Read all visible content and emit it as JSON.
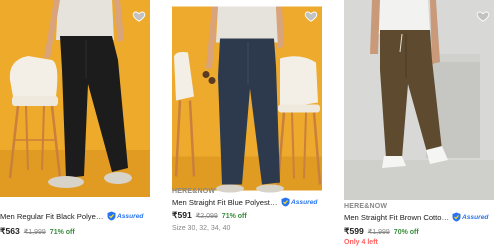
{
  "products": [
    {
      "brand": "",
      "title": "Men Regular Fit Black Polyester ...",
      "assured": "Assured",
      "price": "₹563",
      "mrp": "₹1,999",
      "discount": "71% off",
      "background_color": "#eeaa2b",
      "pants_color": "#1c1c1c",
      "wishlist_icon": "heart-icon"
    },
    {
      "brand": "HERE&NOW",
      "title": "Men Straight Fit Blue Polyester T...",
      "assured": "Assured",
      "price": "₹591",
      "mrp": "₹2,099",
      "discount": "71% off",
      "sizes": "Size 30, 32, 34, 40",
      "background_color": "#edaa2c",
      "pants_color": "#2d3a4e",
      "wishlist_icon": "heart-icon"
    },
    {
      "brand": "HERE&NOW",
      "title": "Men Straight Fit Brown Cotton Bl...",
      "assured": "Assured",
      "price": "₹599",
      "mrp": "₹1,999",
      "discount": "70% off",
      "stock": "Only 4 left",
      "background_color": "#d8d8d6",
      "pants_color": "#5e4a2e",
      "wishlist_icon": "heart-icon"
    }
  ],
  "colors": {
    "accent_blue": "#2874f0",
    "discount_green": "#388e3c",
    "stock_red": "#ff6161"
  }
}
